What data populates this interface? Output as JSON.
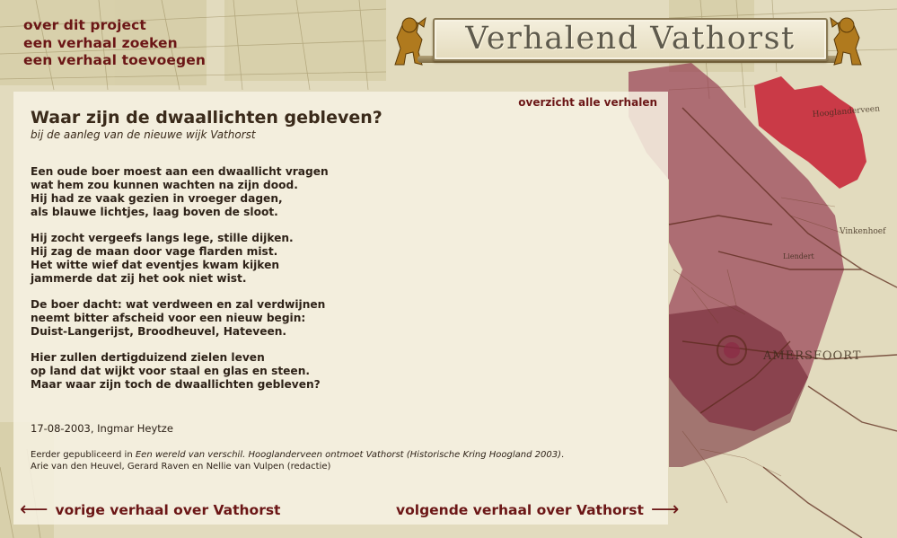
{
  "app": {
    "title": "Verhalend Vathorst"
  },
  "nav": {
    "items": [
      {
        "label": "over dit project"
      },
      {
        "label": "een verhaal zoeken"
      },
      {
        "label": "een verhaal toevoegen"
      }
    ]
  },
  "story": {
    "overview_link": "overzicht alle verhalen",
    "title": "Waar zijn de dwaallichten gebleven?",
    "subtitle": "bij de aanleg van de nieuwe wijk Vathorst",
    "stanzas": [
      [
        "Een oude boer moest aan een dwaallicht vragen",
        "wat hem zou kunnen wachten na zijn dood.",
        "Hij had ze vaak gezien in vroeger dagen,",
        "als blauwe lichtjes, laag boven de sloot."
      ],
      [
        "Hij zocht vergeefs langs lege, stille dijken.",
        "Hij zag de maan door vage flarden mist.",
        "Het witte wief dat eventjes kwam kijken",
        "jammerde dat zij het ook niet wist."
      ],
      [
        "De boer dacht: wat verdween en zal verdwijnen",
        "neemt bitter afscheid voor een nieuw begin:",
        "Duist-Langerijst, Broodheuvel, Hateveen."
      ],
      [
        "Hier zullen dertigduizend zielen leven",
        "op land dat wijkt voor staal en glas en steen.",
        "Maar waar zijn toch de dwaallichten gebleven?"
      ]
    ],
    "date_author": "17-08-2003, Ingmar Heytze",
    "published_prefix": "Eerder gepubliceerd in ",
    "published_title": "Een wereld van verschil. Hooglanderveen ontmoet Vathorst (Historische Kring Hoogland 2003)",
    "published_suffix": ".",
    "editors": "Arie van den Heuvel, Gerard Raven en Nellie van Vulpen (redactie)"
  },
  "footer": {
    "prev_label": "vorige verhaal over Vathorst",
    "next_label": "volgende verhaal over Vathorst",
    "prev_arrow": "⟵",
    "next_arrow": "⟶"
  },
  "map": {
    "labels": [
      "Hooglanderveen",
      "Vinkenhoef",
      "Liendert",
      "AMERSFOORT"
    ]
  },
  "colors": {
    "accent": "#6b1616",
    "map_highlight": "#c8283a",
    "map_region": "#8c2a45",
    "map_paper": "#e3dcc0"
  }
}
